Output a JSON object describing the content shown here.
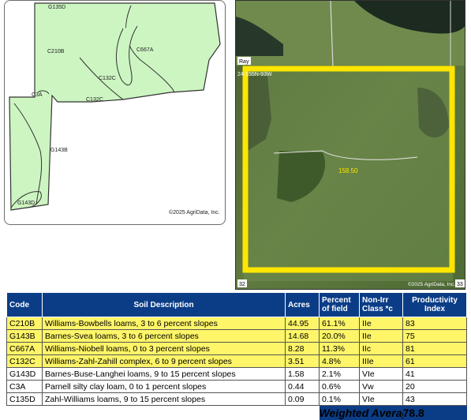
{
  "soil_map": {
    "labels": {
      "g135d_top": "G135D",
      "c210b": "C210B",
      "c667a": "C667A",
      "c132c_mid": "C132C",
      "c132c_low": "C132C",
      "c3a": "C3A",
      "g143b": "G143B",
      "g143d": "G143D"
    },
    "copyright": "©2025 AgriData, Inc.",
    "fill_color": "#cdf5c2",
    "line_color": "#333333"
  },
  "aerial": {
    "road_label": "Ray",
    "section_label_top": "24-155N-93W",
    "section_label_bottom": "32",
    "section_label_bottom_right": "33",
    "acres_label": "158.50",
    "copyright": "©2025 AgriData, Inc.",
    "boundary_color": "#ffe600"
  },
  "table": {
    "headers": {
      "code": "Code",
      "description": "Soil Description",
      "acres": "Acres",
      "percent": "Percent of field",
      "class": "Non-Irr Class *c",
      "productivity": "Productivity Index"
    },
    "rows": [
      {
        "code": "C210B",
        "description": "Williams-Bowbells loams, 3 to 6 percent slopes",
        "acres": "44.95",
        "percent": "61.1%",
        "class": "IIe",
        "productivity": "83",
        "highlight": true
      },
      {
        "code": "G143B",
        "description": "Barnes-Svea loams, 3 to 6 percent slopes",
        "acres": "14.68",
        "percent": "20.0%",
        "class": "IIe",
        "productivity": "75",
        "highlight": true
      },
      {
        "code": "C667A",
        "description": "Williams-Niobell loams, 0 to 3 percent slopes",
        "acres": "8.28",
        "percent": "11.3%",
        "class": "IIc",
        "productivity": "81",
        "highlight": true
      },
      {
        "code": "C132C",
        "description": "Williams-Zahl-Zahill complex, 6 to 9 percent slopes",
        "acres": "3.51",
        "percent": "4.8%",
        "class": "IIIe",
        "productivity": "61",
        "highlight": true
      },
      {
        "code": "G143D",
        "description": "Barnes-Buse-Langhei loams, 9 to 15 percent slopes",
        "acres": "1.58",
        "percent": "2.1%",
        "class": "VIe",
        "productivity": "41",
        "highlight": false
      },
      {
        "code": "C3A",
        "description": "Parnell silty clay loam, 0 to 1 percent slopes",
        "acres": "0.44",
        "percent": "0.6%",
        "class": "Vw",
        "productivity": "20",
        "highlight": false
      },
      {
        "code": "C135D",
        "description": "Zahl-Williams loams, 9 to 15 percent slopes",
        "acres": "0.09",
        "percent": "0.1%",
        "class": "VIe",
        "productivity": "43",
        "highlight": false
      }
    ],
    "weighted_average_label": "Weighted Average",
    "weighted_average_value": "78.8",
    "header_color": "#0b3d87",
    "highlight_color": "#fef568"
  }
}
